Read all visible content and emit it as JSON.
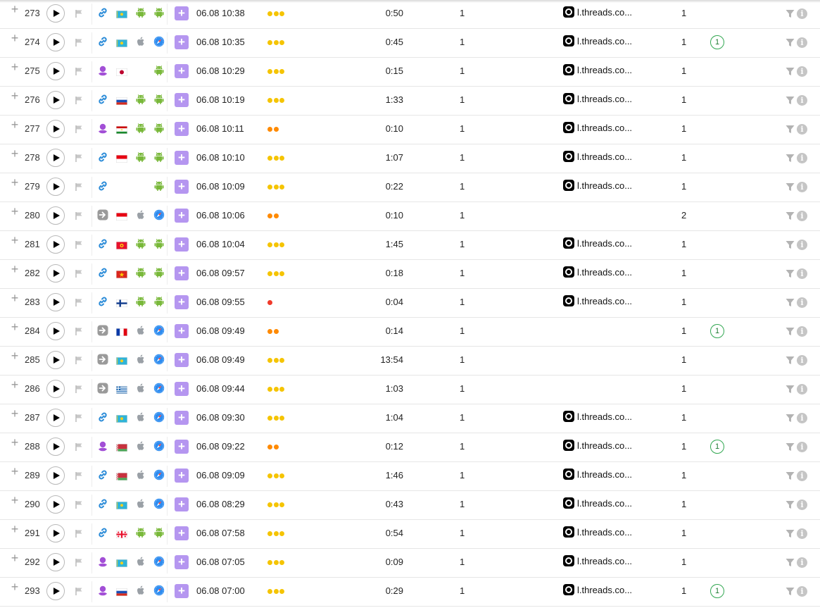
{
  "colors": {
    "dot_3": "#f5c400",
    "dot_2": "#ff8a00",
    "dot_1": "#f03a2a",
    "add_button": "#b596f0",
    "badge_border": "#34a853"
  },
  "icons": {
    "plus": "plus-icon",
    "play": "play-icon",
    "flag_mark": "bookmark-flag-icon",
    "source_link": "link-icon",
    "source_direct": "direct-entry-icon",
    "source_ad": "person-pin-icon",
    "os_android": "android-icon",
    "os_apple": "apple-icon",
    "browser_android": "android-browser-icon",
    "browser_safari": "safari-icon",
    "threads": "threads-icon",
    "filter": "filter-icon",
    "info": "info-icon"
  },
  "labels": {
    "plus": "+",
    "add": "+",
    "info": "i"
  },
  "rows": [
    {
      "num": "273",
      "src": "link",
      "flag": "kz",
      "os": "android",
      "br": "android",
      "datetime": "06.08 10:38",
      "dots": 3,
      "duration": "0:50",
      "pageviews": "1",
      "referrer": "l.threads.co...",
      "visits": "1",
      "badge": ""
    },
    {
      "num": "274",
      "src": "link",
      "flag": "kz",
      "os": "apple",
      "br": "safari",
      "datetime": "06.08 10:35",
      "dots": 3,
      "duration": "0:45",
      "pageviews": "1",
      "referrer": "l.threads.co...",
      "visits": "1",
      "badge": "1"
    },
    {
      "num": "275",
      "src": "ad",
      "flag": "jp",
      "os": "",
      "br": "android",
      "datetime": "06.08 10:29",
      "dots": 3,
      "duration": "0:15",
      "pageviews": "1",
      "referrer": "l.threads.co...",
      "visits": "1",
      "badge": ""
    },
    {
      "num": "276",
      "src": "link",
      "flag": "ru",
      "os": "android",
      "br": "android",
      "datetime": "06.08 10:19",
      "dots": 3,
      "duration": "1:33",
      "pageviews": "1",
      "referrer": "l.threads.co...",
      "visits": "1",
      "badge": ""
    },
    {
      "num": "277",
      "src": "ad",
      "flag": "tj",
      "os": "android",
      "br": "android",
      "datetime": "06.08 10:11",
      "dots": 2,
      "duration": "0:10",
      "pageviews": "1",
      "referrer": "l.threads.co...",
      "visits": "1",
      "badge": ""
    },
    {
      "num": "278",
      "src": "link",
      "flag": "id",
      "os": "android",
      "br": "android",
      "datetime": "06.08 10:10",
      "dots": 3,
      "duration": "1:07",
      "pageviews": "1",
      "referrer": "l.threads.co...",
      "visits": "1",
      "badge": ""
    },
    {
      "num": "279",
      "src": "link",
      "flag": "",
      "os": "",
      "br": "android",
      "datetime": "06.08 10:09",
      "dots": 3,
      "duration": "0:22",
      "pageviews": "1",
      "referrer": "l.threads.co...",
      "visits": "1",
      "badge": ""
    },
    {
      "num": "280",
      "src": "direct",
      "flag": "id",
      "os": "apple",
      "br": "safari",
      "datetime": "06.08 10:06",
      "dots": 2,
      "duration": "0:10",
      "pageviews": "1",
      "referrer": "",
      "visits": "2",
      "badge": ""
    },
    {
      "num": "281",
      "src": "link",
      "flag": "kg",
      "os": "android",
      "br": "android",
      "datetime": "06.08 10:04",
      "dots": 3,
      "duration": "1:45",
      "pageviews": "1",
      "referrer": "l.threads.co...",
      "visits": "1",
      "badge": ""
    },
    {
      "num": "282",
      "src": "link",
      "flag": "vn",
      "os": "android",
      "br": "android",
      "datetime": "06.08 09:57",
      "dots": 3,
      "duration": "0:18",
      "pageviews": "1",
      "referrer": "l.threads.co...",
      "visits": "1",
      "badge": ""
    },
    {
      "num": "283",
      "src": "link",
      "flag": "fi",
      "os": "android",
      "br": "android",
      "datetime": "06.08 09:55",
      "dots": 1,
      "duration": "0:04",
      "pageviews": "1",
      "referrer": "l.threads.co...",
      "visits": "1",
      "badge": ""
    },
    {
      "num": "284",
      "src": "direct",
      "flag": "fr",
      "os": "apple",
      "br": "safari",
      "datetime": "06.08 09:49",
      "dots": 2,
      "duration": "0:14",
      "pageviews": "1",
      "referrer": "",
      "visits": "1",
      "badge": "1"
    },
    {
      "num": "285",
      "src": "direct",
      "flag": "kz",
      "os": "apple",
      "br": "safari",
      "datetime": "06.08 09:49",
      "dots": 3,
      "duration": "13:54",
      "pageviews": "1",
      "referrer": "",
      "visits": "1",
      "badge": ""
    },
    {
      "num": "286",
      "src": "direct",
      "flag": "gr",
      "os": "apple",
      "br": "safari",
      "datetime": "06.08 09:44",
      "dots": 3,
      "duration": "1:03",
      "pageviews": "1",
      "referrer": "",
      "visits": "1",
      "badge": ""
    },
    {
      "num": "287",
      "src": "link",
      "flag": "kz",
      "os": "apple",
      "br": "safari",
      "datetime": "06.08 09:30",
      "dots": 3,
      "duration": "1:04",
      "pageviews": "1",
      "referrer": "l.threads.co...",
      "visits": "1",
      "badge": ""
    },
    {
      "num": "288",
      "src": "ad",
      "flag": "by",
      "os": "apple",
      "br": "safari",
      "datetime": "06.08 09:22",
      "dots": 2,
      "duration": "0:12",
      "pageviews": "1",
      "referrer": "l.threads.co...",
      "visits": "1",
      "badge": "1"
    },
    {
      "num": "289",
      "src": "link",
      "flag": "by",
      "os": "apple",
      "br": "safari",
      "datetime": "06.08 09:09",
      "dots": 3,
      "duration": "1:46",
      "pageviews": "1",
      "referrer": "l.threads.co...",
      "visits": "1",
      "badge": ""
    },
    {
      "num": "290",
      "src": "link",
      "flag": "kz",
      "os": "apple",
      "br": "safari",
      "datetime": "06.08 08:29",
      "dots": 3,
      "duration": "0:43",
      "pageviews": "1",
      "referrer": "l.threads.co...",
      "visits": "1",
      "badge": ""
    },
    {
      "num": "291",
      "src": "link",
      "flag": "ge",
      "os": "android",
      "br": "android",
      "datetime": "06.08 07:58",
      "dots": 3,
      "duration": "0:54",
      "pageviews": "1",
      "referrer": "l.threads.co...",
      "visits": "1",
      "badge": ""
    },
    {
      "num": "292",
      "src": "ad",
      "flag": "kz",
      "os": "apple",
      "br": "safari",
      "datetime": "06.08 07:05",
      "dots": 3,
      "duration": "0:09",
      "pageviews": "1",
      "referrer": "l.threads.co...",
      "visits": "1",
      "badge": ""
    },
    {
      "num": "293",
      "src": "ad",
      "flag": "ru",
      "os": "apple",
      "br": "safari",
      "datetime": "06.08 07:00",
      "dots": 3,
      "duration": "0:29",
      "pageviews": "1",
      "referrer": "l.threads.co...",
      "visits": "1",
      "badge": "1"
    }
  ]
}
